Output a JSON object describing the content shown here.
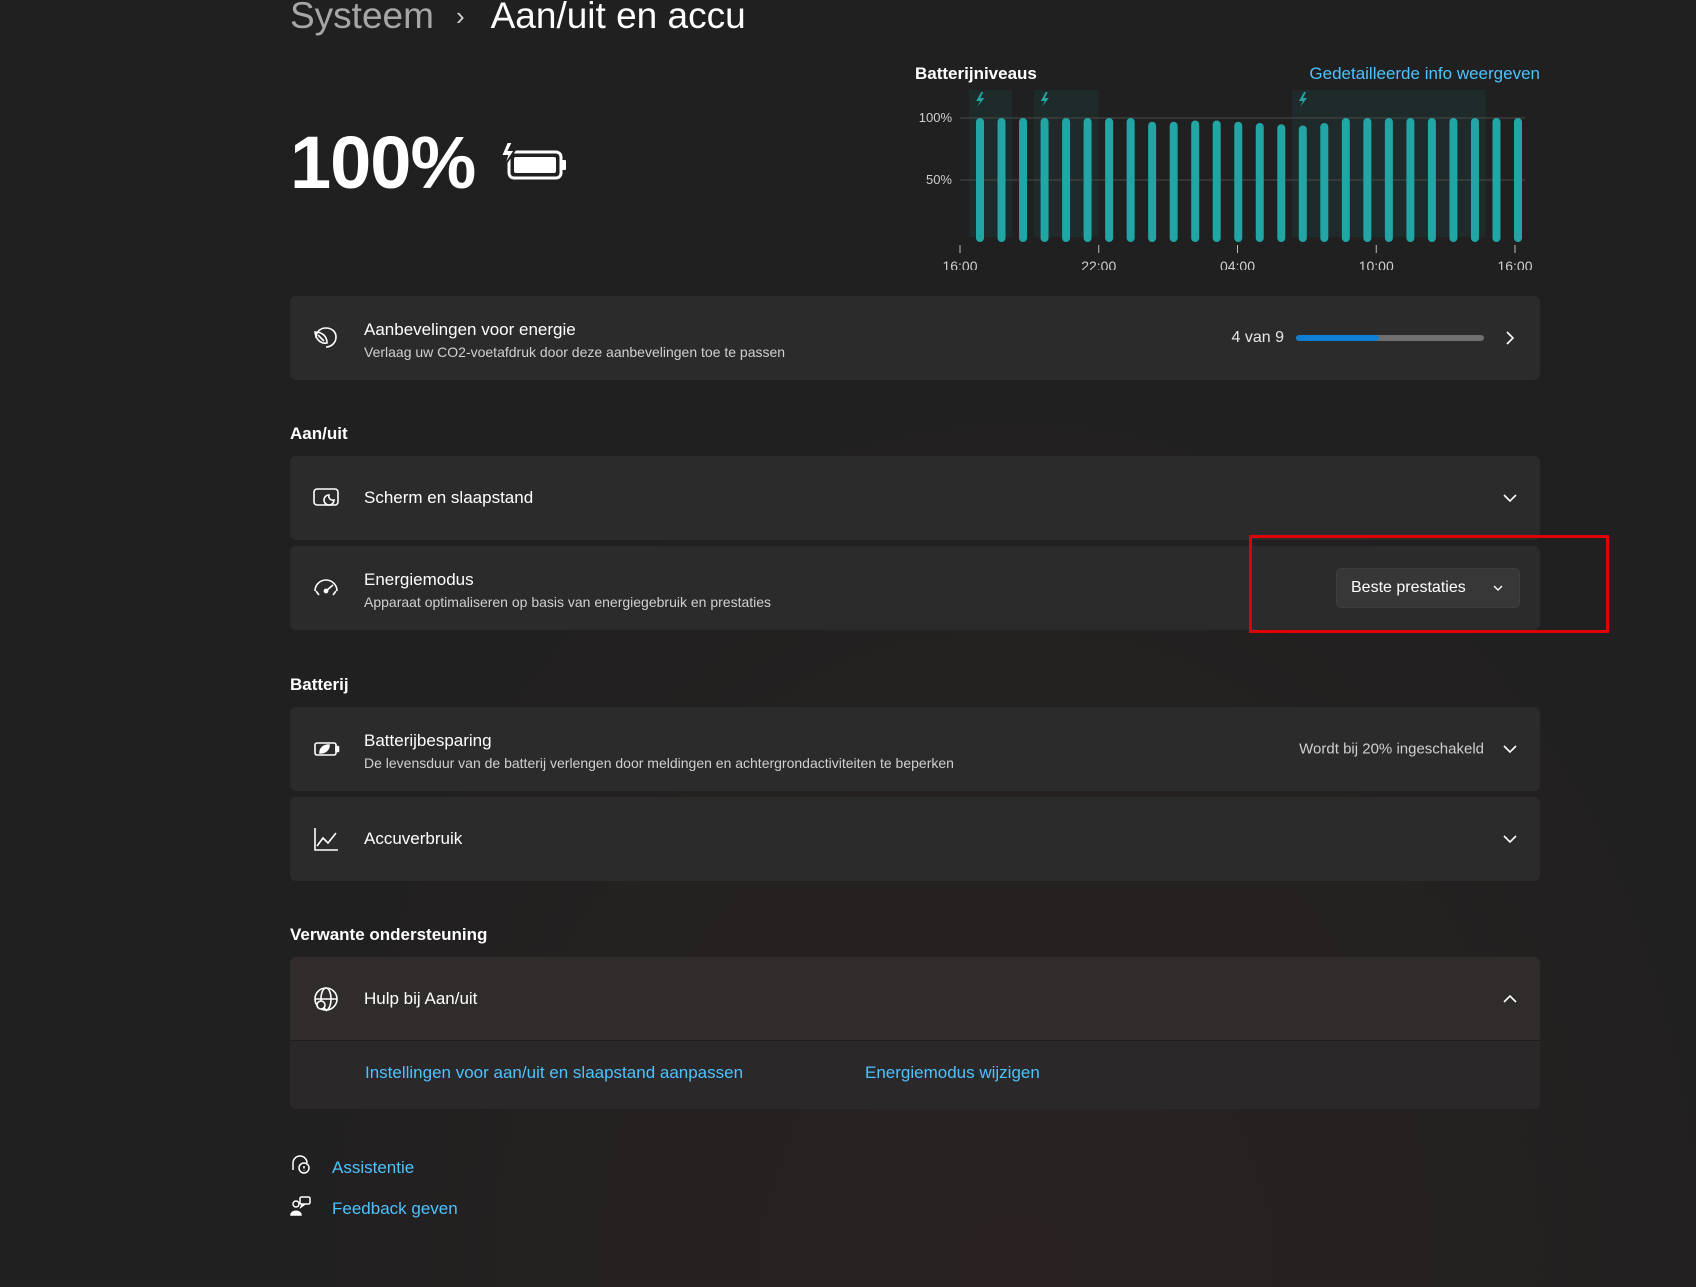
{
  "breadcrumb": {
    "parent": "Systeem",
    "separator": "›",
    "current": "Aan/uit en accu"
  },
  "battery": {
    "percent_label": "100%",
    "charge_level": 1.0,
    "charging": true
  },
  "battery_chart": {
    "title": "Batterijniveaus",
    "details_link": "Gedetailleerde info weergeven",
    "y_ticks": [
      "100%",
      "50%"
    ],
    "x_ticks": [
      "16:00",
      "22:00",
      "04:00",
      "10:00",
      "16:00"
    ]
  },
  "chart_data": {
    "type": "bar",
    "title": "Batterijniveaus",
    "xlabel": "",
    "ylabel": "",
    "ylim": [
      0,
      100
    ],
    "x_ticks": [
      "16:00",
      "22:00",
      "04:00",
      "10:00",
      "16:00"
    ],
    "y_ticks": [
      "50%",
      "100%"
    ],
    "values": [
      100,
      100,
      100,
      100,
      100,
      100,
      100,
      100,
      97,
      97,
      98,
      98,
      97,
      96,
      95,
      94,
      96,
      100,
      100,
      100,
      100,
      100,
      100,
      100,
      100,
      100
    ],
    "charging_intervals": [
      [
        0,
        1
      ],
      [
        3,
        5
      ],
      [
        15,
        23
      ]
    ],
    "bar_color": "#21a5a5",
    "grid": true
  },
  "energy_recommendations": {
    "title": "Aanbevelingen voor energie",
    "subtitle": "Verlaag uw CO2-voetafdruk door deze aanbevelingen toe te passen",
    "progress_text": "4 van 9",
    "progress_fraction": 0.444
  },
  "sections": {
    "power": "Aan/uit",
    "battery": "Batterij",
    "related": "Verwante ondersteuning"
  },
  "screen_sleep": {
    "title": "Scherm en slaapstand"
  },
  "power_mode": {
    "title": "Energiemodus",
    "subtitle": "Apparaat optimaliseren op basis van energiegebruik en prestaties",
    "selected": "Beste prestaties"
  },
  "battery_saver": {
    "title": "Batterijbesparing",
    "subtitle": "De levensduur van de batterij verlengen door meldingen en achtergrondactiviteiten te beperken",
    "status": "Wordt bij 20% ingeschakeld"
  },
  "battery_usage": {
    "title": "Accuverbruik"
  },
  "help": {
    "title": "Hulp bij Aan/uit",
    "links": [
      "Instellingen voor aan/uit en slaapstand aanpassen",
      "Energiemodus wijzigen"
    ]
  },
  "footer": {
    "assist": "Assistentie",
    "feedback": "Feedback geven"
  },
  "colors": {
    "accent": "#4cc2ff",
    "progress": "#0f7fd4",
    "chart_bar": "#21a5a5",
    "highlight": "#e00000"
  },
  "icons": [
    "battery-charging-icon",
    "lightning-icon",
    "leaf-icon",
    "monitor-sleep-icon",
    "gauge-icon",
    "battery-saver-icon",
    "line-chart-icon",
    "globe-icon",
    "chevron-down-icon",
    "chevron-up-icon",
    "chevron-right-icon",
    "assist-icon",
    "feedback-icon"
  ]
}
